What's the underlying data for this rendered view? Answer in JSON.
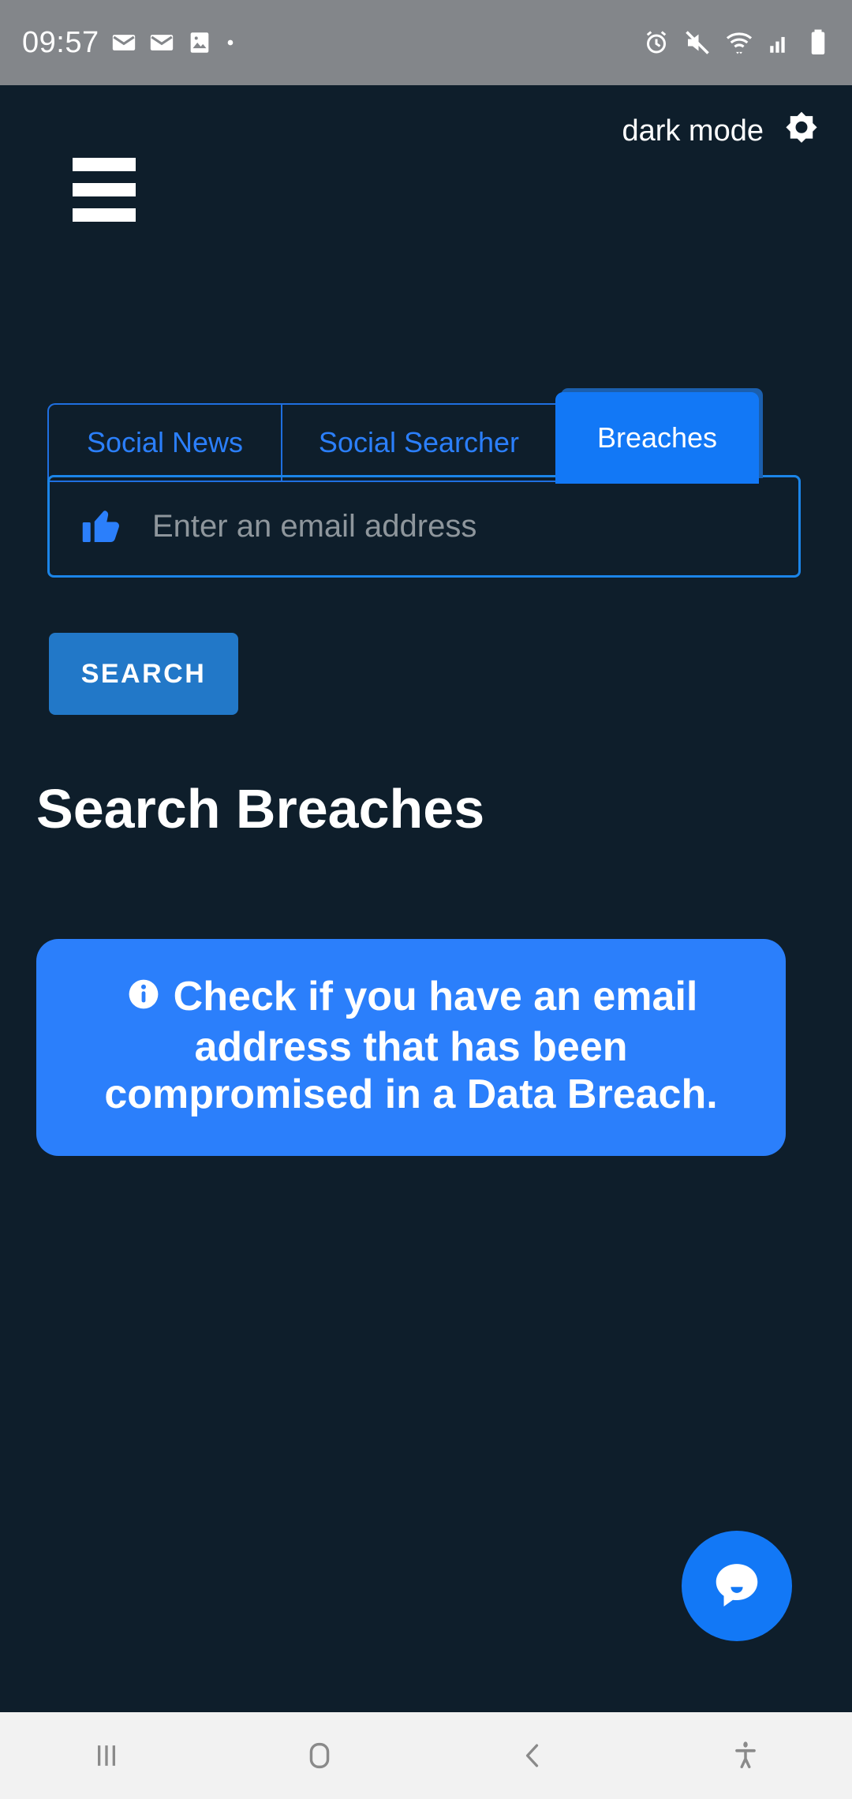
{
  "status_bar": {
    "time": "09:57",
    "left_icons": [
      "mail-icon",
      "mail-icon",
      "image-icon",
      "dot-icon"
    ],
    "right_icons": [
      "alarm-icon",
      "mute-icon",
      "wifi-icon",
      "signal-icon",
      "battery-icon"
    ],
    "background_color": "#83868a"
  },
  "header": {
    "menu_icon": "hamburger-menu-icon",
    "dark_mode_label": "dark mode",
    "dark_mode_icon": "brightness-icon"
  },
  "tabs": [
    {
      "label": "Social News",
      "active": false
    },
    {
      "label": "Social Searcher",
      "active": false
    },
    {
      "label": "Breaches",
      "active": true
    }
  ],
  "search": {
    "icon": "thumbs-up-icon",
    "placeholder": "Enter an email address",
    "value": "",
    "button_label": "SEARCH"
  },
  "main": {
    "page_title": "Search Breaches",
    "info_card": {
      "icon": "info-circle-icon",
      "text": "Check if you have an email address that has been compromised in a Data Breach."
    }
  },
  "chat": {
    "icon": "chat-bubble-icon"
  },
  "nav_bar": {
    "buttons": [
      "recents-icon",
      "home-icon",
      "back-icon",
      "accessibility-icon"
    ],
    "background_color": "#f2f2f2"
  },
  "colors": {
    "page_background": "#0e1e2b",
    "accent_blue": "#2b7ffb",
    "tab_active_blue": "#1278f6",
    "button_blue": "#2278c8",
    "border_blue": "#1b85e8",
    "placeholder_gray": "#8e969c"
  }
}
